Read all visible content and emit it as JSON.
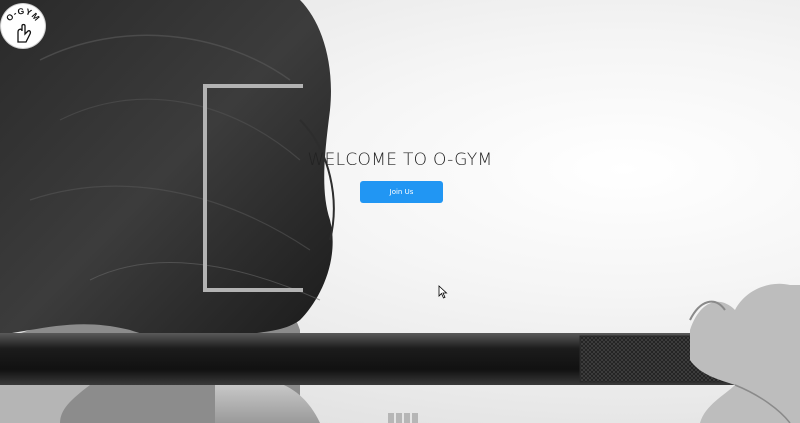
{
  "brand": {
    "logo_text": "O-GYM"
  },
  "hero": {
    "heading": "WELCOME TO O-GYM",
    "cta_label": "Join Us"
  },
  "colors": {
    "accent": "#2196f3",
    "frame": "#b3b3b3"
  },
  "carousel": {
    "slide_count": 4
  },
  "icons": {
    "logo": "flexed-arm-icon",
    "cursor": "mouse-pointer-icon"
  }
}
